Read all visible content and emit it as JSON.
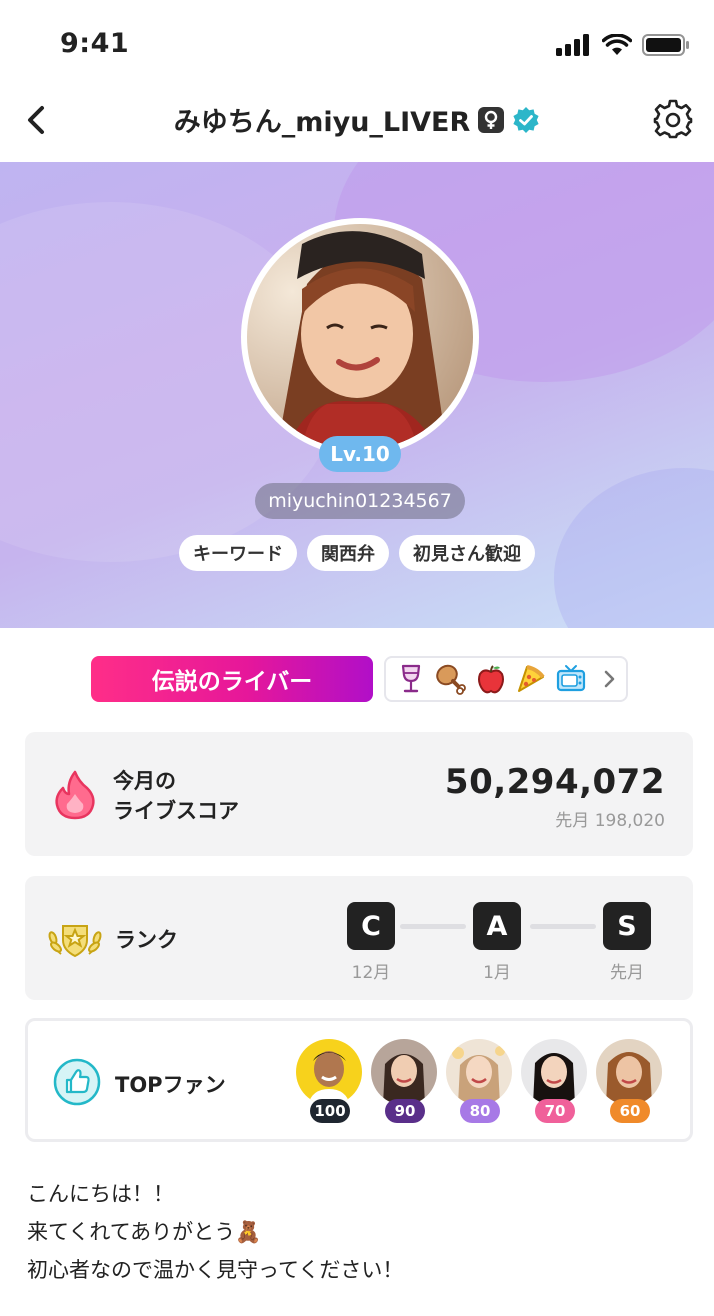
{
  "status_bar": {
    "time": "9:41",
    "icons": [
      "signal-icon",
      "wifi-icon",
      "battery-icon"
    ]
  },
  "header": {
    "title": "みゆちん_miyu_LIVER",
    "gender_icon": "female-icon",
    "verified_icon": "verified-icon",
    "settings_icon": "gear-icon",
    "back_icon": "chevron-left-icon"
  },
  "profile": {
    "level": "Lv.10",
    "user_id": "miyuchin01234567",
    "tags": [
      "キーワード",
      "関西弁",
      "初見さん歓迎"
    ]
  },
  "badges": {
    "title_badge": "伝説のライバー",
    "gifts": [
      "wine-glass-icon",
      "chicken-leg-icon",
      "apple-icon",
      "pizza-icon",
      "tv-icon"
    ]
  },
  "score": {
    "label_line1": "今月の",
    "label_line2": "ライブスコア",
    "value": "50,294,072",
    "previous": "先月 198,020"
  },
  "rank": {
    "label": "ランク",
    "steps": [
      {
        "grade": "C",
        "caption": "12月"
      },
      {
        "grade": "A",
        "caption": "1月"
      },
      {
        "grade": "S",
        "caption": "先月"
      }
    ]
  },
  "top_fans": {
    "label": "TOPファン",
    "fans": [
      {
        "score": "100",
        "color": "#1f2630"
      },
      {
        "score": "90",
        "color": "#5a2f8a"
      },
      {
        "score": "80",
        "color": "#a779e6"
      },
      {
        "score": "70",
        "color": "#f0609a"
      },
      {
        "score": "60",
        "color": "#f08a2a"
      }
    ]
  },
  "bio": {
    "line1": "こんにちは！！",
    "line2": "来てくれてありがとう🧸",
    "line3": "初心者なので温かく見守ってください！"
  }
}
